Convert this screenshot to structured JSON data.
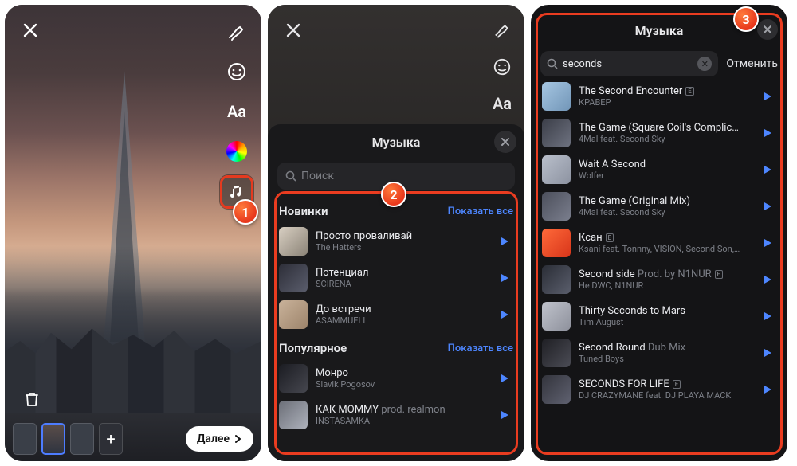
{
  "screen1": {
    "next_label": "Далее"
  },
  "screen2": {
    "sheet_title": "Музыка",
    "search_placeholder": "Поиск",
    "section_new": "Новинки",
    "section_popular": "Популярное",
    "show_all": "Показать все",
    "new_songs": [
      {
        "title": "Просто проваливай",
        "artist": "The Hatters"
      },
      {
        "title": "Потенциал",
        "artist": "SCIRENA"
      },
      {
        "title": "До встречи",
        "artist": "ASAMMUELL"
      }
    ],
    "popular_songs": [
      {
        "title": "Монро",
        "artist": "Slavik Pogosov"
      },
      {
        "title": "КАК MOMMY",
        "sub": "prod. realmon",
        "artist": "INSTASAMKA"
      }
    ]
  },
  "screen3": {
    "title": "Музыка",
    "search_value": "seconds",
    "cancel": "Отменить",
    "results": [
      {
        "title": "The Second Encounter",
        "e": true,
        "artist": "КРАВЕР"
      },
      {
        "title": "The Game (Square Coil's Complic…",
        "artist": "4Mal feat. Second Sky"
      },
      {
        "title": "Wait A Second",
        "artist": "Wolfer"
      },
      {
        "title": "The Game (Original Mix)",
        "artist": "4Mal feat. Second Sky"
      },
      {
        "title": "Ксан",
        "e": true,
        "artist": "Ksani feat. Tonnny, VISION, Second Son,…"
      },
      {
        "title": "Second side",
        "sub": "Prod. by N1NUR",
        "e": true,
        "artist": "Не DWC, N1NUR"
      },
      {
        "title": "Thirty Seconds to Mars",
        "artist": "Tim August"
      },
      {
        "title": "Second Round",
        "sub": "Dub Mix",
        "artist": "Tuned Boys"
      },
      {
        "title": "SECONDS FOR LIFE",
        "e": true,
        "artist": "DJ CRAZYMANE feat. DJ PLAYA MACK"
      }
    ]
  },
  "badges": {
    "b1": "1",
    "b2": "2",
    "b3": "3"
  }
}
